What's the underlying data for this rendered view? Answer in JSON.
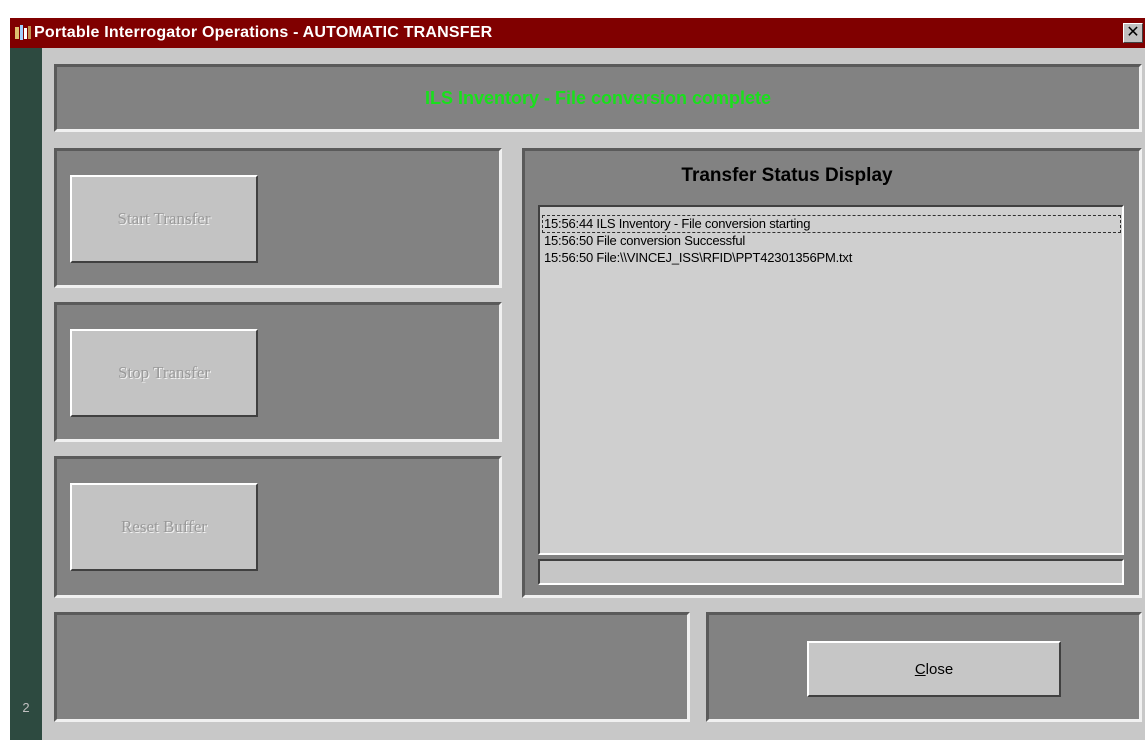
{
  "window": {
    "title": "Portable Interrogator Operations  -  AUTOMATIC TRANSFER",
    "close_glyph": "✕",
    "strip_number": "2"
  },
  "header": {
    "message": "ILS Inventory - File conversion complete",
    "message_color": "#19e01c"
  },
  "buttons": {
    "start_label": "Start Transfer",
    "stop_label": "Stop Transfer",
    "reset_label": "Reset Buffer",
    "close_label": "Close",
    "close_mnemonic": "C"
  },
  "status_display": {
    "title": "Transfer Status Display",
    "lines": [
      "15:56:44 ILS Inventory - File conversion starting",
      "15:56:50 File conversion Successful",
      "15:56:50 File:\\\\VINCEJ_ISS\\RFID\\PPT42301356PM.txt"
    ]
  },
  "colors": {
    "title_bar": "#800000",
    "panel": "#828282",
    "left_strip": "#2d4a40"
  }
}
